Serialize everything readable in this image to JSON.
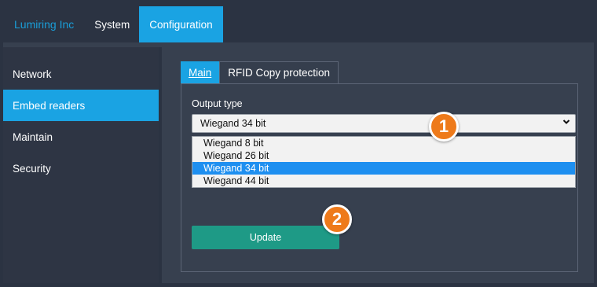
{
  "header": {
    "brand": "Lumiring Inc",
    "nav": [
      {
        "label": "System",
        "active": false
      },
      {
        "label": "Configuration",
        "active": true
      }
    ]
  },
  "sidebar": {
    "items": [
      {
        "label": "Network",
        "active": false
      },
      {
        "label": "Embed readers",
        "active": true
      },
      {
        "label": "Maintain",
        "active": false
      },
      {
        "label": "Security",
        "active": false
      }
    ]
  },
  "tabs": [
    {
      "label": "Main",
      "active": true
    },
    {
      "label": "RFID Copy protection",
      "active": false
    }
  ],
  "form": {
    "output_type_label": "Output type",
    "selected_value": "Wiegand 34 bit",
    "options": [
      "Wiegand 8 bit",
      "Wiegand 26 bit",
      "Wiegand 34 bit",
      "Wiegand 44 bit"
    ],
    "update_button": "Update"
  },
  "markers": [
    "1",
    "2"
  ],
  "colors": {
    "accent": "#1aa3e3",
    "button": "#1e9a86",
    "marker": "#ee7a1a",
    "selected_option": "#1e8ff0"
  },
  "icons": {
    "dropdown": "chevron-down-icon"
  }
}
